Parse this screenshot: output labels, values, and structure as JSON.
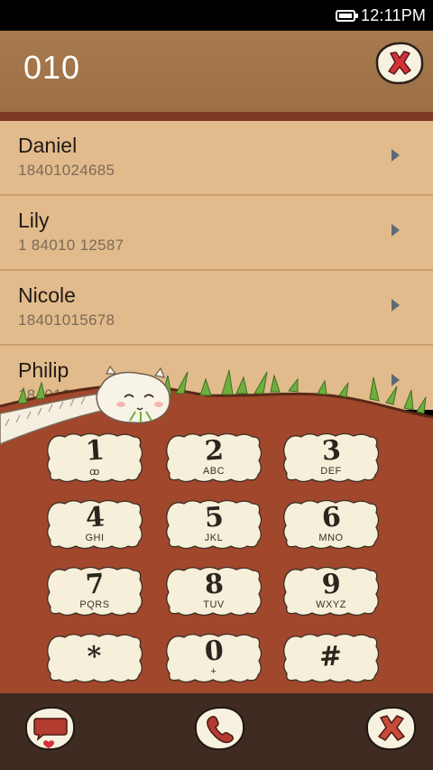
{
  "status_bar": {
    "time": "12:11PM"
  },
  "header": {
    "dial_number": "010"
  },
  "contacts": [
    {
      "name": "Daniel",
      "phone": "18401024685"
    },
    {
      "name": "Lily",
      "phone": "1 84010 12587"
    },
    {
      "name": "Nicole",
      "phone": "18401015678"
    },
    {
      "name": "Philip",
      "phone": "18401015"
    }
  ],
  "keypad": [
    {
      "digit": "1",
      "letters": "ꝏ"
    },
    {
      "digit": "2",
      "letters": "ABC"
    },
    {
      "digit": "3",
      "letters": "DEF"
    },
    {
      "digit": "4",
      "letters": "GHI"
    },
    {
      "digit": "5",
      "letters": "JKL"
    },
    {
      "digit": "6",
      "letters": "MNO"
    },
    {
      "digit": "7",
      "letters": "PQRS"
    },
    {
      "digit": "8",
      "letters": "TUV"
    },
    {
      "digit": "9",
      "letters": "WXYZ"
    },
    {
      "digit": "*",
      "letters": ""
    },
    {
      "digit": "0",
      "letters": "+"
    },
    {
      "digit": "#",
      "letters": ""
    }
  ],
  "colors": {
    "header": "#a77a4f",
    "list_row": "#e2bb8c",
    "dirt": "#a1472c",
    "key_fluff": "#f6efd9",
    "bottom_bar": "#3f2b22",
    "accent_red": "#d6313a"
  },
  "icons": {
    "clear": "clear-x-icon",
    "message": "message-heart-icon",
    "call": "phone-icon",
    "close": "close-x-icon"
  }
}
